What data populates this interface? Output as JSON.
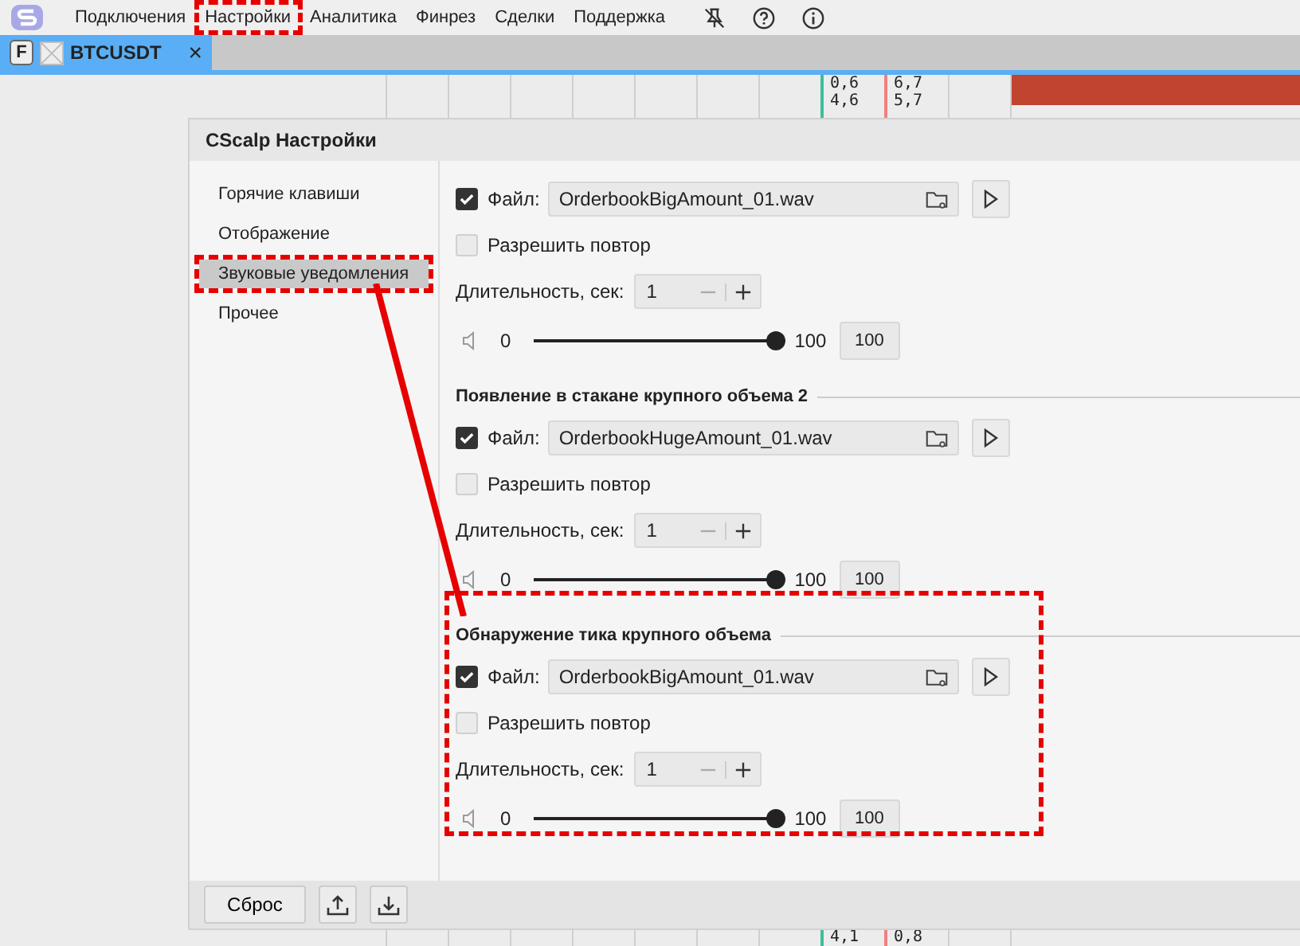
{
  "menu": [
    {
      "label": "Подключения",
      "highlighted": false
    },
    {
      "label": "Настройки",
      "highlighted": true
    },
    {
      "label": "Аналитика",
      "highlighted": false
    },
    {
      "label": "Финрез",
      "highlighted": false
    },
    {
      "label": "Сделки",
      "highlighted": false
    },
    {
      "label": "Поддержка",
      "highlighted": false
    }
  ],
  "tab": {
    "badge": "F",
    "label": "BTCUSDT",
    "selected": true,
    "close": "×"
  },
  "book": {
    "top_bid": [
      "0,6",
      "4,6"
    ],
    "top_ask": [
      "6,7",
      "5,7"
    ],
    "bottom_bid": "4,1",
    "bottom_ask": "0,8"
  },
  "dialog": {
    "title": "CScalp Настройки",
    "sidebar": [
      {
        "label": "Горячие клавиши",
        "selected": false,
        "highlighted": false
      },
      {
        "label": "Отображение",
        "selected": false,
        "highlighted": false
      },
      {
        "label": "Звуковые уведомления",
        "selected": true,
        "highlighted": true
      },
      {
        "label": "Прочее",
        "selected": false,
        "highlighted": false
      }
    ],
    "sections": [
      {
        "highlighted": false,
        "file_checked": true,
        "file_label": "Файл:",
        "file": "OrderbookBigAmount_01.wav",
        "repeat_checked": false,
        "repeat_label": "Разрешить повтор",
        "duration_label": "Длительность, сек:",
        "duration": "1",
        "volume_min": "0",
        "volume_max": "100",
        "level": 1,
        "volume_value": "100"
      },
      {
        "title": "Появление в стакане крупного объема 2",
        "highlighted": false,
        "file_checked": true,
        "file_label": "Файл:",
        "file": "OrderbookHugeAmount_01.wav",
        "repeat_checked": false,
        "repeat_label": "Разрешить повтор",
        "duration_label": "Длительность, сек:",
        "duration": "1",
        "volume_min": "0",
        "volume_max": "100",
        "level": 1,
        "volume_value": "100"
      },
      {
        "title": "Обнаружение тика крупного объема",
        "highlighted": true,
        "file_checked": true,
        "file_label": "Файл:",
        "file": "OrderbookBigAmount_01.wav",
        "repeat_checked": false,
        "repeat_label": "Разрешить повтор",
        "duration_label": "Длительность, сек:",
        "duration": "1",
        "volume_min": "0",
        "volume_max": "100",
        "level": 1,
        "volume_value": "100"
      }
    ],
    "footer": {
      "reset": "Сброс"
    }
  }
}
